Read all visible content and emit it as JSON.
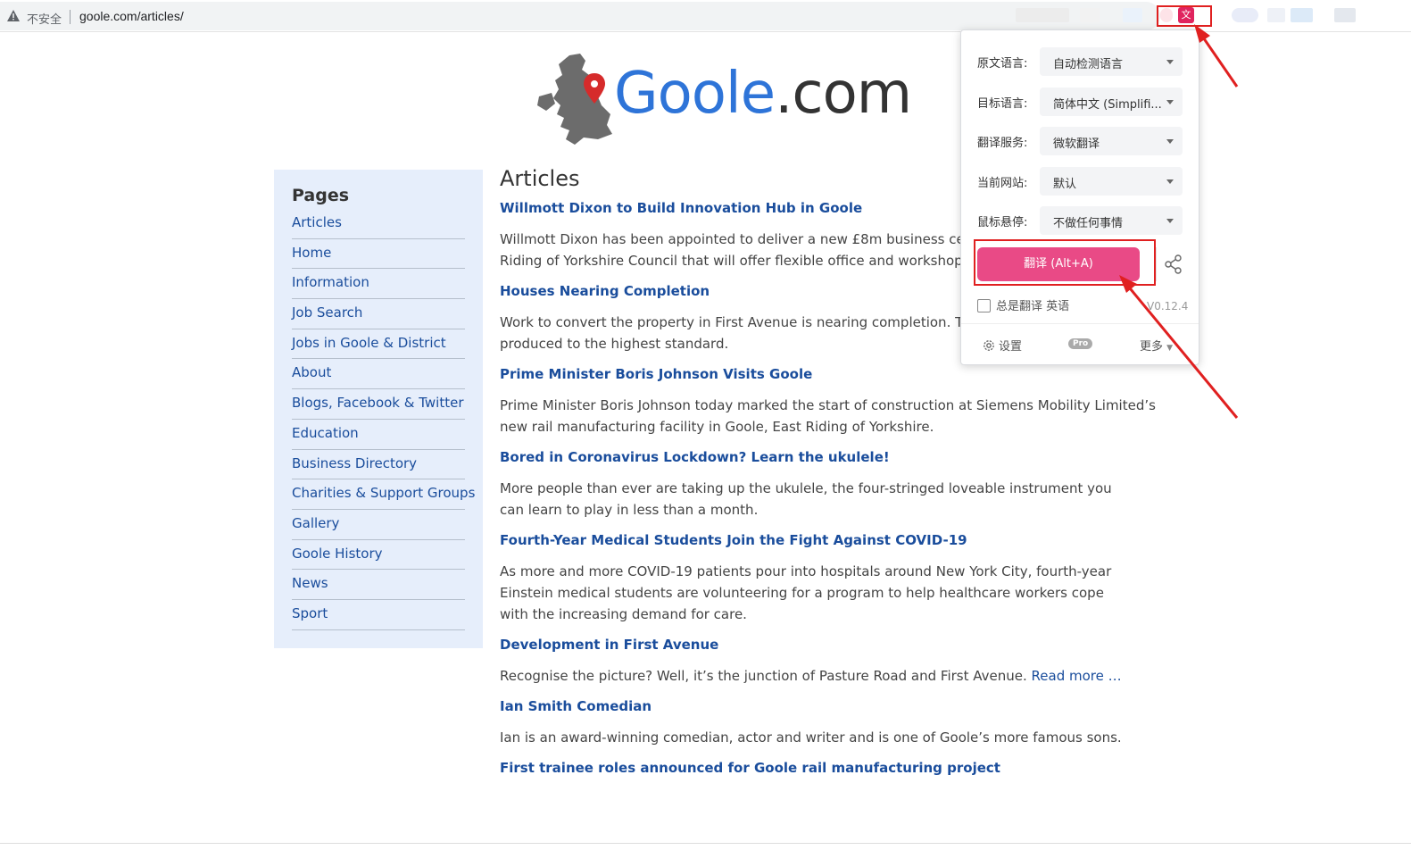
{
  "browser": {
    "security_label": "不安全",
    "url": "goole.com/articles/"
  },
  "logo": {
    "brand": "Goole",
    "suffix": ".com"
  },
  "sidebar": {
    "heading": "Pages",
    "items": [
      {
        "label": "Articles"
      },
      {
        "label": "Home"
      },
      {
        "label": "Information"
      },
      {
        "label": "Job Search"
      },
      {
        "label": "Jobs in Goole & District"
      },
      {
        "label": "About"
      },
      {
        "label": "Blogs, Facebook & Twitter"
      },
      {
        "label": "Education"
      },
      {
        "label": "Business Directory"
      },
      {
        "label": "Charities & Support Groups"
      },
      {
        "label": "Gallery"
      },
      {
        "label": "Goole History"
      },
      {
        "label": "News"
      },
      {
        "label": "Sport"
      }
    ]
  },
  "main": {
    "heading": "Articles",
    "articles": [
      {
        "title": "Willmott Dixon to Build Innovation Hub in Goole",
        "body": "Willmott Dixon has been appointed to deliver a new £8m business centre ar\nRiding of Yorkshire Council that will offer flexible office and workshop spac"
      },
      {
        "title": "Houses Nearing Completion",
        "body": "Work to convert the property in First Avenue is nearing completion. The fou\nproduced to the highest standard."
      },
      {
        "title": "Prime Minister Boris Johnson Visits Goole",
        "body": "Prime Minister Boris Johnson today marked the start of construction at Siemens Mobility Limited’s new rail manufacturing facility in Goole, East Riding of Yorkshire."
      },
      {
        "title": "Bored in Coronavirus Lockdown? Learn the ukulele!",
        "body": "More people than ever are taking up the ukulele, the four-stringed loveable instrument you can learn to play in less than a month."
      },
      {
        "title": "Fourth-Year Medical Students Join the Fight Against COVID-19",
        "body": "As more and more COVID-19 patients pour into hospitals around New York City, fourth-year Einstein medical students are volunteering for a program to help healthcare workers cope with the increasing demand for care."
      },
      {
        "title": "Development in First Avenue",
        "body": "Recognise the picture? Well, it’s the junction of Pasture Road and First Avenue.",
        "more": "Read more …"
      },
      {
        "title": "Ian Smith Comedian",
        "body": "Ian is an award-winning comedian, actor and writer and is one of Goole’s more famous sons."
      },
      {
        "title": "First trainee roles announced for Goole rail manufacturing project"
      }
    ]
  },
  "translator": {
    "rows": [
      {
        "label": "原文语言:",
        "value": "自动检测语言"
      },
      {
        "label": "目标语言:",
        "value": "简体中文 (Simplifi..."
      },
      {
        "label": "翻译服务:",
        "value": "微软翻译"
      },
      {
        "label": "当前网站:",
        "value": "默认"
      },
      {
        "label": "鼠标悬停:",
        "value": "不做任何事情"
      }
    ],
    "translate_button": "翻译 (Alt+A)",
    "always_translate": "总是翻译 英语",
    "version": "V0.12.4",
    "settings": "设置",
    "pro_badge": "Pro",
    "more": "更多"
  },
  "colors": {
    "link": "#1a4d9c",
    "sidebar_bg": "#e6eefb",
    "logo_blue": "#2e74d8",
    "translate_pink": "#e94a86",
    "annotation_red": "#e02020"
  }
}
